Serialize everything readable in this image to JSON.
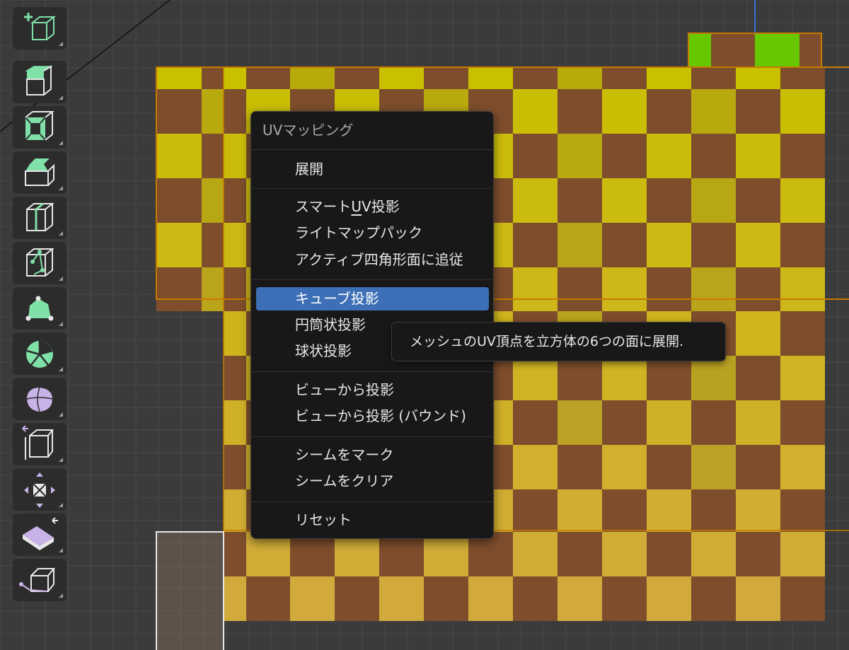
{
  "menu": {
    "title": "UVマッピング",
    "items": [
      {
        "label": "展開"
      },
      {
        "label_pre": "スマート",
        "label_ul": "U",
        "label_post": "V投影"
      },
      {
        "label": "ライトマップパック"
      },
      {
        "label": "アクティブ四角形面に追従"
      },
      {
        "label": "キューブ投影"
      },
      {
        "label": "円筒状投影"
      },
      {
        "label": "球状投影"
      },
      {
        "label": "ビューから投影"
      },
      {
        "label": "ビューから投影 (バウンド)"
      },
      {
        "label": "シームをマーク"
      },
      {
        "label": "シームをクリア"
      },
      {
        "label": "リセット"
      }
    ]
  },
  "tooltip": {
    "text": "メッシュのUV頂点を立方体の6つの面に展開."
  },
  "toolbar": {
    "tools": [
      {
        "icon": "add-cube-icon"
      },
      {
        "icon": "extrude-region-icon"
      },
      {
        "icon": "inset-faces-icon"
      },
      {
        "icon": "bevel-icon"
      },
      {
        "icon": "loop-cut-icon"
      },
      {
        "icon": "knife-icon"
      },
      {
        "icon": "poly-build-icon"
      },
      {
        "icon": "spin-icon"
      },
      {
        "icon": "smooth-icon"
      },
      {
        "icon": "edge-slide-icon"
      },
      {
        "icon": "shrink-fatten-icon"
      },
      {
        "icon": "shear-icon"
      },
      {
        "icon": "rip-region-icon"
      }
    ]
  },
  "colors": {
    "accent": "#3c6fb5",
    "menu_bg": "#181818",
    "tool_icon": "#7fe0a8",
    "tool_icon_purple": "#c9b2e8",
    "texture_yellow": "#c9c000",
    "texture_brown": "#7e4e2c",
    "texture_green": "#67c700"
  }
}
